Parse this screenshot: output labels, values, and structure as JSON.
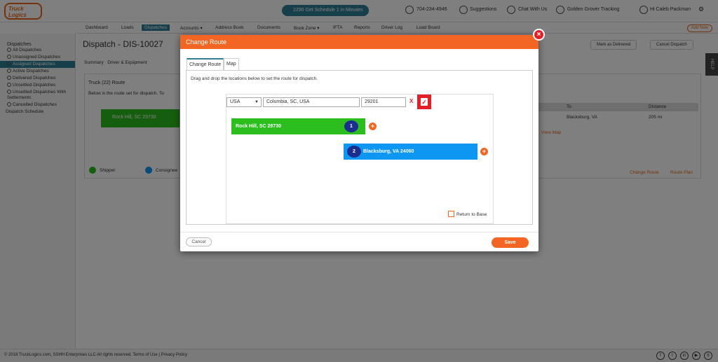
{
  "app": {
    "logo_text": "Truck Logics",
    "promo": "Get Schedule 1 in Minutes",
    "promo_code": "2290",
    "phone": "704-234-4946",
    "suggestions": "Suggestions",
    "chat": "Chat With Us",
    "tracking": "Golden Grover Tracking",
    "user": "Hi Caleb Packman"
  },
  "nav": {
    "items": [
      "Dashboard",
      "Loads",
      "Dispatches",
      "Accounts ▾",
      "Address Book",
      "Documents",
      "Book Zone ▾",
      "IFTA",
      "Reports",
      "Driver Log",
      "Load Board"
    ],
    "active": "Dispatches",
    "add_new": "Add New"
  },
  "sidebar": {
    "heading": "Dispatches",
    "items": [
      "All Dispatches",
      "Unassigned Dispatches",
      "Assigned Dispatches",
      "Active Dispatches",
      "Delivered Dispatches",
      "Unsettled Dispatches",
      "Unsettled Dispatches With Settlements",
      "Cancelled Dispatches"
    ],
    "active_index": 2,
    "schedule": "Dispatch Schedule"
  },
  "page": {
    "title": "Dispatch - DIS-10027",
    "mark_delivered": "Mark as Delivered",
    "cancel_dispatch": "Cancel Dispatch",
    "tabs": [
      "Summary",
      "Driver & Equipment"
    ],
    "section_title": "Truck (22) Route",
    "section_desc": "Below is the route set for dispatch. To",
    "origin": "Rock Hill, SC 29730",
    "table_to": "To",
    "table_distance": "Distance",
    "row_to": "Blacksburg, VA",
    "row_distance": "205 mi",
    "view_map": "View Map",
    "legend_shipper": "Shipper",
    "legend_consignee": "Consignee",
    "change_route": "Change Route",
    "route_plan": "Route Plan",
    "footer": "© 2018 TruckLogics.com, SSHH Enterprises LLC All rights reserved. Terms of Use | Privacy Policy",
    "help": "HELP"
  },
  "modal": {
    "title": "Change Route",
    "close": "×",
    "tabs": {
      "change_route": "Change Route",
      "map": "Map"
    },
    "instructions": "Drag and drop the locations below to set the route for dispatch.",
    "country": "USA",
    "location_value": "Columbia, SC, USA",
    "zip_value": "29201",
    "clear": "X",
    "confirm": "✓",
    "stops": [
      {
        "number": "1",
        "label": "Rock Hill, SC 29730"
      },
      {
        "number": "2",
        "label": "Blacksburg, VA 24060"
      }
    ],
    "add": "+",
    "return_to_base": "Return to Base",
    "cancel": "Cancel",
    "save": "Save"
  },
  "colors": {
    "accent": "#f26522",
    "shipper_green": "#2cbd1f",
    "consignee_blue": "#0d96f2",
    "number_badge": "#1b2d8f",
    "close_red": "#e41e26",
    "nav_active": "#2e7d96"
  }
}
